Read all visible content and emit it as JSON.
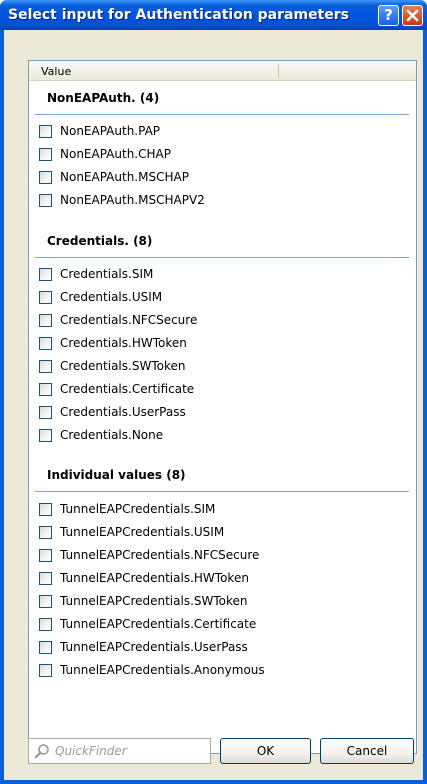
{
  "window": {
    "title": "Select input for Authentication parameters",
    "help_glyph": "?"
  },
  "list": {
    "column_header": "Value",
    "groups": [
      {
        "title": "NonEAPAuth. (4)",
        "items": [
          "NonEAPAuth.PAP",
          "NonEAPAuth.CHAP",
          "NonEAPAuth.MSCHAP",
          "NonEAPAuth.MSCHAPV2"
        ]
      },
      {
        "title": "Credentials. (8)",
        "items": [
          "Credentials.SIM",
          "Credentials.USIM",
          "Credentials.NFCSecure",
          "Credentials.HWToken",
          "Credentials.SWToken",
          "Credentials.Certificate",
          "Credentials.UserPass",
          "Credentials.None"
        ]
      },
      {
        "title": "Individual values (8)",
        "items": [
          "TunnelEAPCredentials.SIM",
          "TunnelEAPCredentials.USIM",
          "TunnelEAPCredentials.NFCSecure",
          "TunnelEAPCredentials.HWToken",
          "TunnelEAPCredentials.SWToken",
          "TunnelEAPCredentials.Certificate",
          "TunnelEAPCredentials.UserPass",
          "TunnelEAPCredentials.Anonymous"
        ]
      }
    ]
  },
  "footer": {
    "quickfinder_placeholder": "QuickFinder",
    "quickfinder_value": "",
    "ok_label": "OK",
    "cancel_label": "Cancel"
  },
  "icons": {
    "help": "help-icon",
    "close": "close-icon",
    "quickfinder": "magnifier-icon"
  },
  "colors": {
    "titlebar": "#0054e3",
    "dialog_bg": "#ece9d8",
    "group_rule": "#7ea5d6"
  }
}
